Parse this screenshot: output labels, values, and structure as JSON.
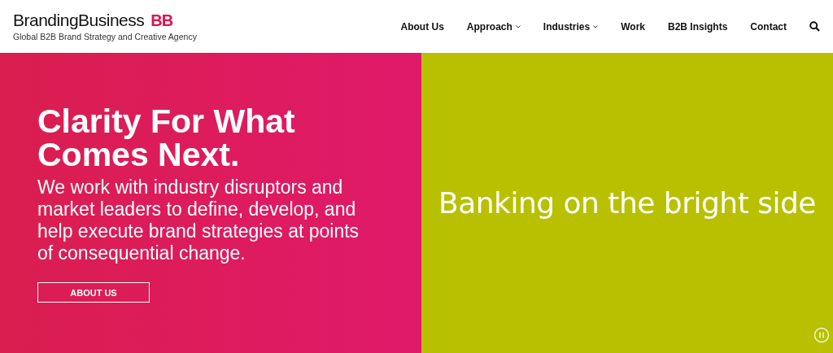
{
  "header": {
    "logo": {
      "wordmark": "BrandingBusiness",
      "mark": "BB",
      "tagline": "Global B2B Brand Strategy and Creative Agency"
    },
    "nav": [
      {
        "label": "About Us",
        "dropdown": false
      },
      {
        "label": "Approach",
        "dropdown": true
      },
      {
        "label": "Industries",
        "dropdown": true
      },
      {
        "label": "Work",
        "dropdown": false
      },
      {
        "label": "B2B Insights",
        "dropdown": false
      },
      {
        "label": "Contact",
        "dropdown": false
      }
    ]
  },
  "hero": {
    "heading": "Clarity For What Comes Next.",
    "text": "We work with industry disruptors and market leaders to define, develop, and help execute brand strategies at points of consequential change.",
    "button": "ABOUT US"
  },
  "slide": {
    "caption": "Banking on the bright side"
  }
}
